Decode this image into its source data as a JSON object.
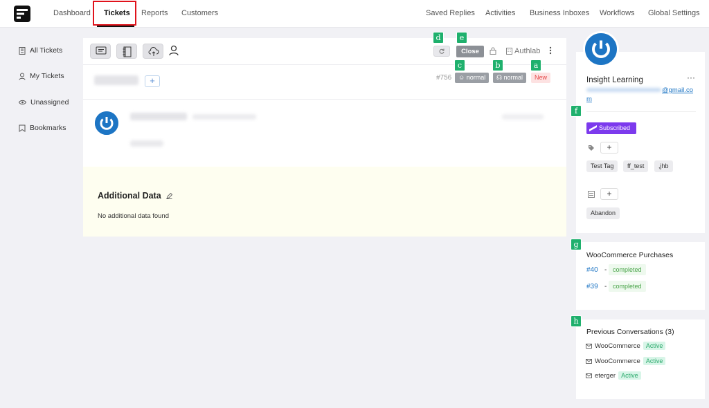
{
  "nav": {
    "left": [
      "Dashboard",
      "Tickets",
      "Reports",
      "Customers"
    ],
    "right": [
      "Saved Replies",
      "Activities",
      "Business Inboxes",
      "Workflows",
      "Global Settings"
    ]
  },
  "sidebar": {
    "items": [
      {
        "label": "All Tickets",
        "icon": "document-icon"
      },
      {
        "label": "My Tickets",
        "icon": "user-icon"
      },
      {
        "label": "Unassigned",
        "icon": "eye-icon"
      },
      {
        "label": "Bookmarks",
        "icon": "bookmark-icon"
      }
    ]
  },
  "ticket": {
    "number": "#756",
    "close_label": "Close",
    "mailbox": "Authlab",
    "priority_client": "normal",
    "priority_agent": "normal",
    "status": "New",
    "add_label": "+"
  },
  "additional_data": {
    "title": "Additional Data",
    "empty_text": "No additional data found"
  },
  "customer": {
    "name": "Insight Learning",
    "email_line1": "@gmail.co",
    "email_line2": "m",
    "subscribed": "Subscribed",
    "tags": [
      "Test Tag",
      "ff_test",
      ",jhb"
    ],
    "lists": [
      "Abandon"
    ]
  },
  "woo": {
    "title": "WooCommerce Purchases",
    "orders": [
      {
        "id": "#40",
        "status": "completed"
      },
      {
        "id": "#39",
        "status": "completed"
      }
    ]
  },
  "previous": {
    "title": "Previous Conversations (3)",
    "items": [
      {
        "label": "WooCommerce",
        "status": "Active"
      },
      {
        "label": "WooCommerce",
        "status": "Active"
      },
      {
        "label": "eterger",
        "status": "Active"
      }
    ]
  },
  "markers": [
    "a",
    "b",
    "c",
    "d",
    "e",
    "f",
    "g",
    "h"
  ],
  "colors": {
    "highlight": "#e0121b",
    "marker": "#1fb06d",
    "brand_blue": "#1d75c4",
    "subscribed": "#7c3aed"
  }
}
